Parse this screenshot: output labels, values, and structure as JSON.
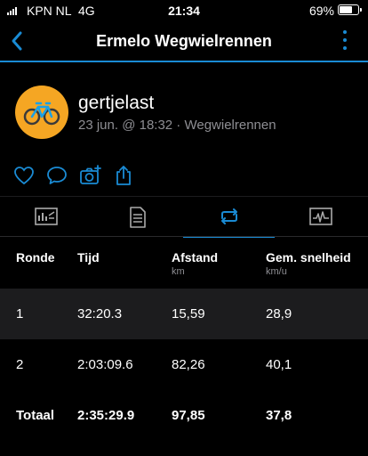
{
  "status_bar": {
    "carrier": "KPN NL",
    "network": "4G",
    "time": "21:34",
    "battery": "69%",
    "battery_level": 0.69
  },
  "nav": {
    "back_icon": "chevron-left-icon",
    "title": "Ermelo Wegwielrennen",
    "more_icon": "vertical-dots-icon",
    "accent_color": "#1a8bd4"
  },
  "activity": {
    "avatar_icon": "bicycle-icon",
    "avatar_color": "#f5a623",
    "username": "gertjelast",
    "meta": "23 jun. @ 18:32 · Wegwielrennen"
  },
  "actions": [
    {
      "icon": "heart-icon"
    },
    {
      "icon": "comment-icon"
    },
    {
      "icon": "add-photo-icon"
    },
    {
      "icon": "share-icon"
    }
  ],
  "tabs": [
    {
      "icon": "stats-icon",
      "active": false
    },
    {
      "icon": "details-icon",
      "active": false
    },
    {
      "icon": "laps-icon",
      "active": true
    },
    {
      "icon": "chart-icon",
      "active": false
    }
  ],
  "laps_table": {
    "headers": [
      {
        "label": "Ronde",
        "unit": ""
      },
      {
        "label": "Tijd",
        "unit": ""
      },
      {
        "label": "Afstand",
        "unit": "km"
      },
      {
        "label": "Gem. snelheid",
        "unit": "km/u"
      }
    ],
    "rows": [
      [
        "1",
        "32:20.3",
        "15,59",
        "28,9"
      ],
      [
        "2",
        "2:03:09.6",
        "82,26",
        "40,1"
      ]
    ],
    "total": [
      "Totaal",
      "2:35:29.9",
      "97,85",
      "37,8"
    ]
  }
}
